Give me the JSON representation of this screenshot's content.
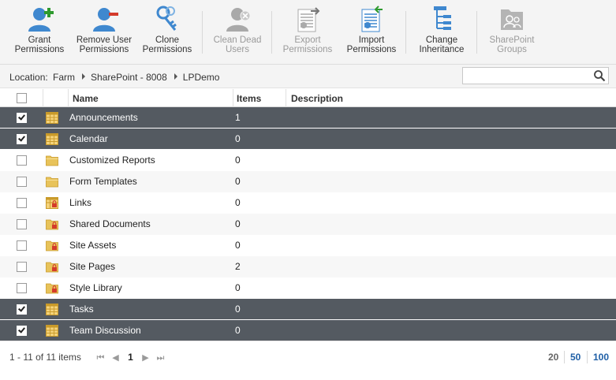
{
  "ribbon": {
    "grant": [
      "Grant",
      "Permissions"
    ],
    "remove_user": [
      "Remove User",
      "Permissions"
    ],
    "clone": [
      "Clone",
      "Permissions"
    ],
    "clean_dead": [
      "Clean Dead",
      "Users"
    ],
    "export": [
      "Export",
      "Permissions"
    ],
    "import": [
      "Import",
      "Permissions"
    ],
    "change_inheritance": [
      "Change",
      "Inheritance"
    ],
    "sp_groups": [
      "SharePoint",
      "Groups"
    ]
  },
  "location": {
    "label": "Location:",
    "crumbs": [
      "Farm",
      "SharePoint - 8008",
      "LPDemo"
    ]
  },
  "search": {
    "placeholder": ""
  },
  "grid": {
    "headers": {
      "name": "Name",
      "items": "Items",
      "description": "Description"
    },
    "rows": [
      {
        "name": "Announcements",
        "items": "1",
        "description": "",
        "checked": true,
        "icon": "list-icon"
      },
      {
        "name": "Calendar",
        "items": "0",
        "description": "",
        "checked": true,
        "icon": "list-icon"
      },
      {
        "name": "Customized Reports",
        "items": "0",
        "description": "",
        "checked": false,
        "icon": "folder-icon"
      },
      {
        "name": "Form Templates",
        "items": "0",
        "description": "",
        "checked": false,
        "icon": "folder-icon"
      },
      {
        "name": "Links",
        "items": "0",
        "description": "",
        "checked": false,
        "icon": "locked-list-icon"
      },
      {
        "name": "Shared Documents",
        "items": "0",
        "description": "",
        "checked": false,
        "icon": "locked-folder-icon"
      },
      {
        "name": "Site Assets",
        "items": "0",
        "description": "",
        "checked": false,
        "icon": "locked-folder-icon"
      },
      {
        "name": "Site Pages",
        "items": "2",
        "description": "",
        "checked": false,
        "icon": "locked-folder-icon"
      },
      {
        "name": "Style Library",
        "items": "0",
        "description": "",
        "checked": false,
        "icon": "locked-folder-icon"
      },
      {
        "name": "Tasks",
        "items": "0",
        "description": "",
        "checked": true,
        "icon": "list-icon"
      },
      {
        "name": "Team Discussion",
        "items": "0",
        "description": "",
        "checked": true,
        "icon": "list-icon"
      }
    ]
  },
  "footer": {
    "count": "1 - 11 of 11 items",
    "pager": {
      "first": "⏮",
      "prev": "◀",
      "current": "1",
      "next": "▶",
      "last": "⏭"
    },
    "page_sizes": [
      "20",
      "50",
      "100"
    ]
  },
  "colors": {
    "selected_row": "#545a61",
    "accent_blue": "#2b78c5",
    "page_size_active": "#1f5fa6",
    "folder": "#e8c35a"
  }
}
